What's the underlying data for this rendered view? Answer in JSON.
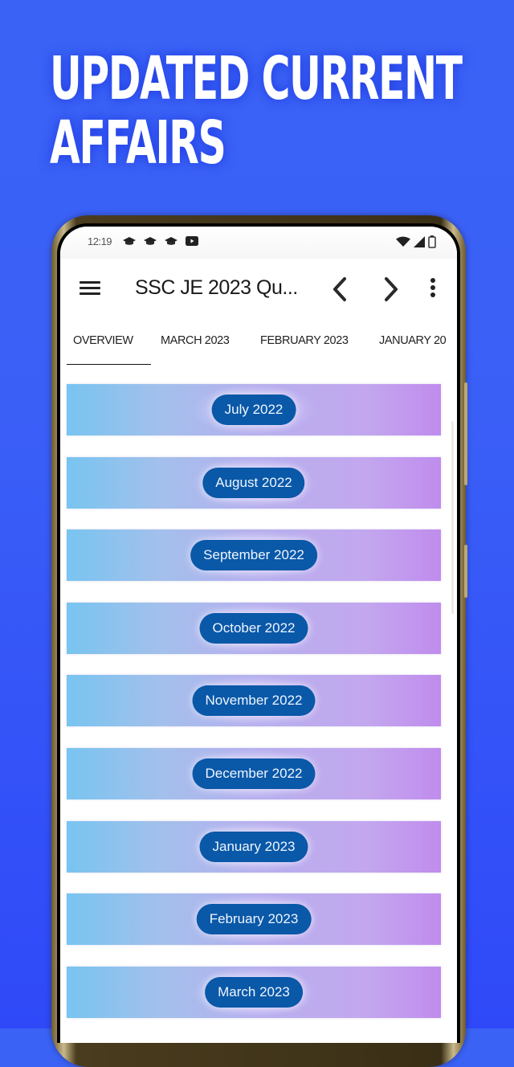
{
  "promo": {
    "headline_line1": "UPDATED CURRENT",
    "headline_line2": "AFFAIRS",
    "background_color": "#3a5ff7"
  },
  "status_bar": {
    "time": "12:19",
    "notification_icons": [
      "graduation-cap-icon",
      "graduation-cap-icon",
      "graduation-cap-icon",
      "youtube-icon"
    ],
    "system_icons": [
      "wifi-icon",
      "signal-icon",
      "battery-icon"
    ]
  },
  "app_bar": {
    "menu_icon": "menu-icon",
    "title": "SSC JE 2023 Qu...",
    "prev_icon": "chevron-left-icon",
    "next_icon": "chevron-right-icon",
    "more_icon": "more-vertical-icon"
  },
  "tabs": [
    {
      "label": "OVERVIEW",
      "active": true
    },
    {
      "label": "MARCH 2023",
      "active": false
    },
    {
      "label": "FEBRUARY 2023",
      "active": false
    },
    {
      "label": "JANUARY 20",
      "active": false
    }
  ],
  "months": [
    {
      "label": "July 2022"
    },
    {
      "label": "August 2022"
    },
    {
      "label": "September 2022"
    },
    {
      "label": "October 2022"
    },
    {
      "label": "November 2022"
    },
    {
      "label": "December 2022"
    },
    {
      "label": "January 2023"
    },
    {
      "label": "February 2023"
    },
    {
      "label": "March 2023"
    }
  ],
  "colors": {
    "pill": "#0a58a8",
    "row_gradient_start": "#78c4f0",
    "row_gradient_end": "#c08ced"
  }
}
